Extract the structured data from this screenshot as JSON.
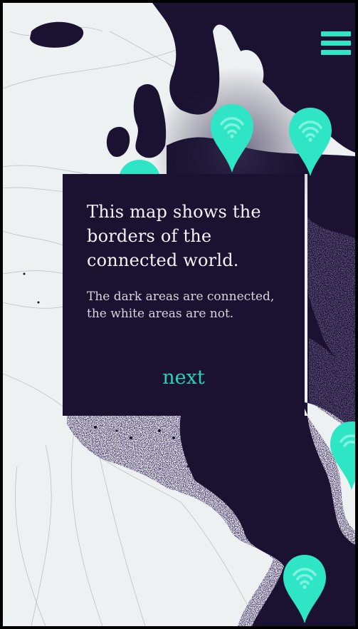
{
  "app": {
    "accent_color": "#2ee6c6",
    "land_color": "#1a1230",
    "sea_color": "#eef1f2"
  },
  "menu": {
    "icon": "hamburger-icon"
  },
  "map": {
    "pin_icon": "wifi-icon"
  },
  "dialog": {
    "title": "This map shows the borders of the connected world.",
    "description": "The dark areas are connected, the white areas are not.",
    "next_label": "next"
  }
}
